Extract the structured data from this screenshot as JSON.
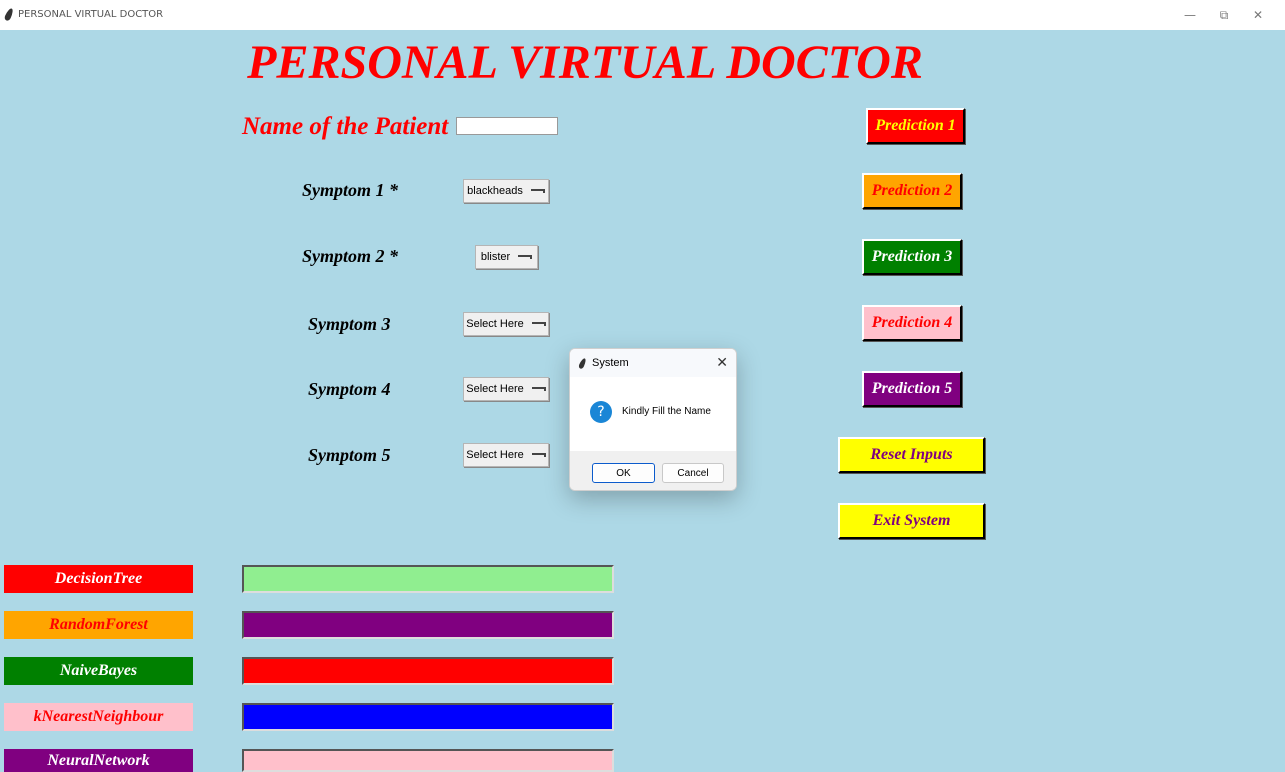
{
  "window": {
    "title": "PERSONAL VIRTUAL DOCTOR",
    "minimize": "—",
    "maximize": "⧉",
    "close": "✕"
  },
  "heading": "PERSONAL VIRTUAL DOCTOR",
  "patient": {
    "label": "Name of the Patient *",
    "value": ""
  },
  "symptoms": [
    {
      "label": "Symptom 1 *",
      "selected": "blackheads"
    },
    {
      "label": "Symptom 2 *",
      "selected": "blister"
    },
    {
      "label": "Symptom 3",
      "selected": "Select Here"
    },
    {
      "label": "Symptom 4",
      "selected": "Select Here"
    },
    {
      "label": "Symptom 5",
      "selected": "Select Here"
    }
  ],
  "buttons": {
    "prediction1": "Prediction 1",
    "prediction2": "Prediction 2",
    "prediction3": "Prediction 3",
    "prediction4": "Prediction 4",
    "prediction5": "Prediction 5",
    "reset": "Reset Inputs",
    "exit": "Exit System"
  },
  "models": [
    {
      "label": "DecisionTree",
      "bg": "#ff0000",
      "fg": "#ffffff",
      "result_bg": "#90ee90"
    },
    {
      "label": "RandomForest",
      "bg": "#ffa500",
      "fg": "#ff0000",
      "result_bg": "#800080"
    },
    {
      "label": "NaiveBayes",
      "bg": "#008000",
      "fg": "#ffffff",
      "result_bg": "#ff0000"
    },
    {
      "label": "kNearestNeighbour",
      "bg": "#ffc0cb",
      "fg": "#ff0000",
      "result_bg": "#0000ff"
    },
    {
      "label": "NeuralNetwork",
      "bg": "#800080",
      "fg": "#ffffff",
      "result_bg": "#ffc0cb"
    }
  ],
  "dialog": {
    "title": "System",
    "icon": "question-icon",
    "message": "Kindly Fill the Name",
    "ok": "OK",
    "cancel": "Cancel"
  },
  "colors": {
    "background": "#add8e6",
    "heading": "#ff0000"
  }
}
